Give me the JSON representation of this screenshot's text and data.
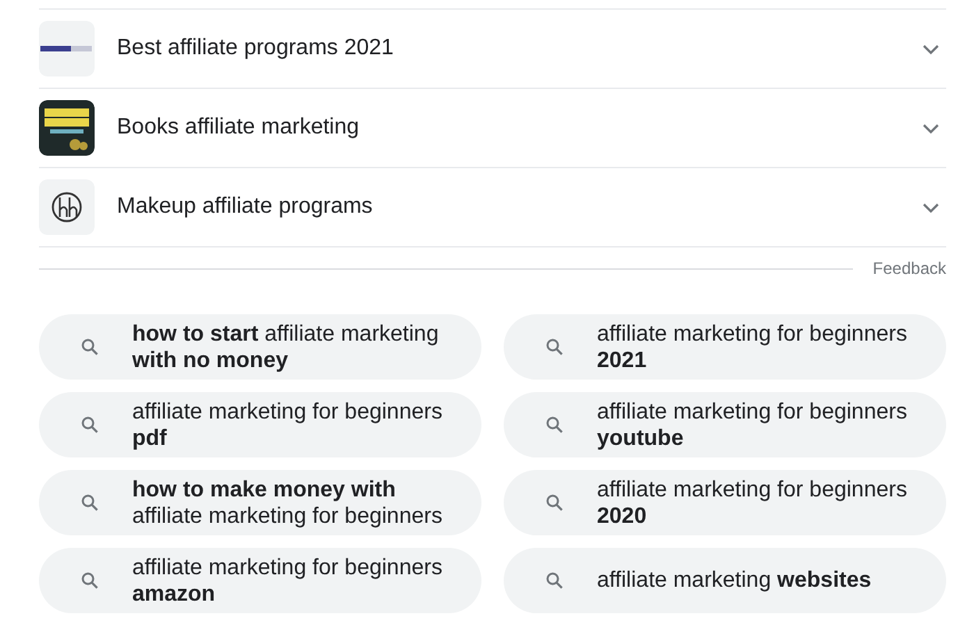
{
  "related_questions": [
    {
      "kind": "bars",
      "text": "Best affiliate programs 2021",
      "expanded": false
    },
    {
      "kind": "book",
      "text": "Books affiliate marketing",
      "expanded": false
    },
    {
      "kind": "circle",
      "text": "Makeup affiliate programs",
      "expanded": false
    }
  ],
  "feedback": "Feedback",
  "related_searches": [
    {
      "text": "**how to start** affiliate marketing **with no money**"
    },
    {
      "text": "affiliate marketing for beginners **2021**"
    },
    {
      "text": "affiliate marketing for beginners **pdf**"
    },
    {
      "text": "affiliate marketing for beginners **youtube**"
    },
    {
      "text": "**how to make money with** affiliate marketing for beginners"
    },
    {
      "text": "affiliate marketing for beginners **2020**"
    },
    {
      "text": "affiliate marketing for beginners **amazon**"
    },
    {
      "text": "affiliate marketing **websites**"
    }
  ]
}
